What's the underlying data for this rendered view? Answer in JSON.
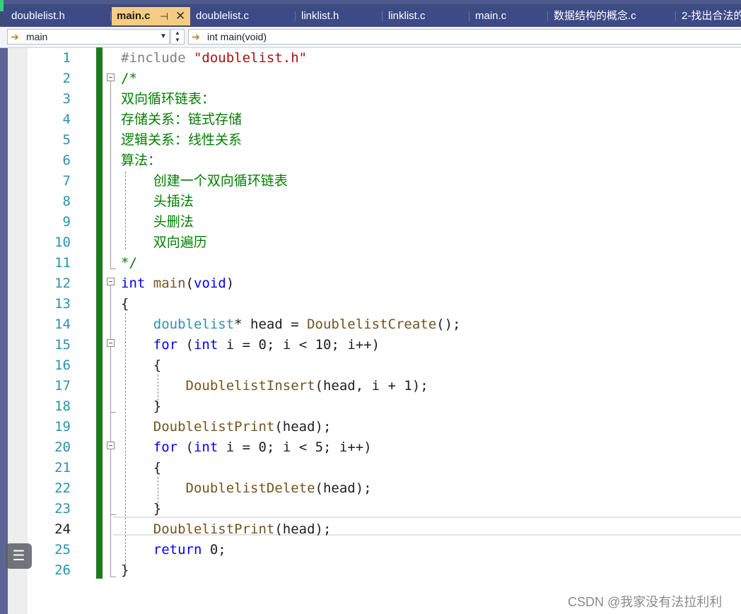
{
  "tabs": [
    {
      "label": "doublelist.h",
      "active": false
    },
    {
      "label": "main.c",
      "active": true,
      "pin_icon": "pin-icon",
      "close_icon": "close-icon"
    },
    {
      "label": "doublelist.c",
      "active": false
    },
    {
      "label": "linklist.h",
      "active": false
    },
    {
      "label": "linklist.c",
      "active": false
    },
    {
      "label": "main.c",
      "active": false
    },
    {
      "label": "数据结构的概念.c",
      "active": false
    },
    {
      "label": "2-找出合法的",
      "active": false
    }
  ],
  "nav": {
    "scope_value": "main",
    "member_value": "int main(void)"
  },
  "editor": {
    "current_line": 24,
    "line_numbers": [
      "1",
      "2",
      "3",
      "4",
      "5",
      "6",
      "7",
      "8",
      "9",
      "10",
      "11",
      "12",
      "13",
      "14",
      "15",
      "16",
      "17",
      "18",
      "19",
      "20",
      "21",
      "22",
      "23",
      "24",
      "25",
      "26"
    ],
    "lines": [
      [
        [
          "pp",
          "#include "
        ],
        [
          "str",
          "\"doublelist.h\""
        ]
      ],
      [
        [
          "cm",
          "/*"
        ]
      ],
      [
        [
          "cm",
          "双向循环链表："
        ]
      ],
      [
        [
          "cm",
          "存储关系：链式存储"
        ]
      ],
      [
        [
          "cm",
          "逻辑关系：线性关系"
        ]
      ],
      [
        [
          "cm",
          "算法："
        ]
      ],
      [
        [
          "cm",
          "    创建一个双向循环链表"
        ]
      ],
      [
        [
          "cm",
          "    头插法"
        ]
      ],
      [
        [
          "cm",
          "    头删法"
        ]
      ],
      [
        [
          "cm",
          "    双向遍历"
        ]
      ],
      [
        [
          "cm",
          "*/"
        ]
      ],
      [
        [
          "kw",
          "int"
        ],
        [
          "",
          " "
        ],
        [
          "fn",
          "main"
        ],
        [
          "",
          "("
        ],
        [
          "kw",
          "void"
        ],
        [
          "",
          ")"
        ]
      ],
      [
        [
          "",
          "{"
        ]
      ],
      [
        [
          "",
          "    "
        ],
        [
          "tp",
          "doublelist"
        ],
        [
          "",
          "* head = "
        ],
        [
          "fn",
          "DoublelistCreate"
        ],
        [
          "",
          "();"
        ]
      ],
      [
        [
          "",
          "    "
        ],
        [
          "kw",
          "for"
        ],
        [
          "",
          " ("
        ],
        [
          "kw",
          "int"
        ],
        [
          "",
          " i = 0; i < 10; i++)"
        ]
      ],
      [
        [
          "",
          "    {"
        ]
      ],
      [
        [
          "",
          "        "
        ],
        [
          "fn",
          "DoublelistInsert"
        ],
        [
          "",
          "(head, i + 1);"
        ]
      ],
      [
        [
          "",
          "    }"
        ]
      ],
      [
        [
          "",
          "    "
        ],
        [
          "fn",
          "DoublelistPrint"
        ],
        [
          "",
          "(head);"
        ]
      ],
      [
        [
          "",
          "    "
        ],
        [
          "kw",
          "for"
        ],
        [
          "",
          " ("
        ],
        [
          "kw",
          "int"
        ],
        [
          "",
          " i = 0; i < 5; i++)"
        ]
      ],
      [
        [
          "",
          "    {"
        ]
      ],
      [
        [
          "",
          "        "
        ],
        [
          "fn",
          "DoublelistDelete"
        ],
        [
          "",
          "(head);"
        ]
      ],
      [
        [
          "",
          "    }"
        ]
      ],
      [
        [
          "",
          "    "
        ],
        [
          "fn",
          "DoublelistPrint"
        ],
        [
          "",
          "(head);"
        ]
      ],
      [
        [
          "",
          "    "
        ],
        [
          "kw",
          "return"
        ],
        [
          "",
          " 0;"
        ]
      ],
      [
        [
          "",
          "}"
        ]
      ]
    ]
  },
  "floating_button_icon": "list-icon",
  "watermark": "CSDN @我家没有法拉利利"
}
